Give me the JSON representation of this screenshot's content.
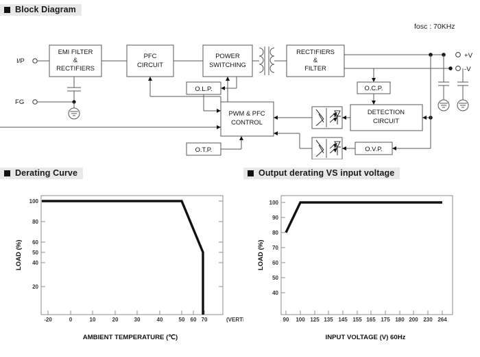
{
  "sections": {
    "block_diagram": {
      "title": "Block Diagram",
      "bullet_color": "#111111",
      "header_bg": "#e8e8e8"
    },
    "derating_curve": {
      "title": "Derating Curve"
    },
    "output_derating": {
      "title": "Output derating VS input voltage"
    }
  },
  "block_diagram": {
    "fosc_label": "fosc : 70KHz",
    "terminals": [
      {
        "name": "input",
        "label": "I/P"
      },
      {
        "name": "frame-ground",
        "label": "FG"
      },
      {
        "name": "output-positive",
        "label": "+V"
      },
      {
        "name": "output-negative",
        "label": "-V"
      }
    ],
    "blocks": [
      {
        "id": "emi",
        "lines": [
          "EMI FILTER",
          "&",
          "RECTIFIERS"
        ]
      },
      {
        "id": "pfc",
        "lines": [
          "PFC",
          "CIRCUIT"
        ]
      },
      {
        "id": "power_sw",
        "lines": [
          "POWER",
          "SWITCHING"
        ]
      },
      {
        "id": "rect_filter",
        "lines": [
          "RECTIFIERS",
          "&",
          "FILTER"
        ]
      },
      {
        "id": "olp",
        "lines": [
          "O.L.P."
        ]
      },
      {
        "id": "pwm_pfc",
        "lines": [
          "PWM & PFC",
          "CONTROL"
        ]
      },
      {
        "id": "otp",
        "lines": [
          "O.T.P."
        ]
      },
      {
        "id": "ocp",
        "lines": [
          "O.C.P."
        ]
      },
      {
        "id": "detection",
        "lines": [
          "DETECTION",
          "CIRCUIT"
        ]
      },
      {
        "id": "ovp",
        "lines": [
          "O.V.P."
        ]
      }
    ]
  },
  "chart_data": [
    {
      "type": "line",
      "name": "derating-curve",
      "title": "Derating Curve",
      "xlabel": "AMBIENT TEMPERATURE (℃)",
      "ylabel": "LOAD (%)",
      "xlim": [
        -30,
        75
      ],
      "ylim": [
        0,
        110
      ],
      "xticks": [
        -20,
        0,
        10,
        20,
        30,
        40,
        50,
        60,
        70
      ],
      "xtick_labels": [
        "-20",
        "0",
        "10",
        "20",
        "30",
        "40",
        "50",
        "60",
        "70"
      ],
      "yticks": [
        20,
        40,
        50,
        60,
        80,
        100
      ],
      "ytick_labels": [
        "20",
        "40",
        "50",
        "60",
        "80",
        "100"
      ],
      "grid": false,
      "legend": "none",
      "annotation": "(VERTICAL)",
      "x": [
        -30,
        50,
        69,
        69
      ],
      "y": [
        100,
        100,
        50,
        0
      ],
      "points": [
        {
          "x": -30,
          "y": 100
        },
        {
          "x": 50,
          "y": 100
        },
        {
          "x": 69,
          "y": 50
        },
        {
          "x": 69,
          "y": 0
        }
      ]
    },
    {
      "type": "line",
      "name": "output-derating-vs-input-voltage",
      "title": "Output derating VS input voltage",
      "xlabel": "INPUT VOLTAGE (V) 60Hz",
      "ylabel": "LOAD (%)",
      "xlim": [
        0,
        11
      ],
      "ylim": [
        30,
        110
      ],
      "xticks": [
        0,
        1,
        2,
        3,
        4,
        5,
        6,
        7,
        8,
        9,
        10,
        11
      ],
      "xtick_labels": [
        "90",
        "100",
        "125",
        "135",
        "145",
        "155",
        "165",
        "175",
        "180",
        "200",
        "230",
        "264"
      ],
      "yticks": [
        40,
        50,
        60,
        70,
        80,
        90,
        100
      ],
      "ytick_labels": [
        "40",
        "50",
        "60",
        "70",
        "80",
        "90",
        "100"
      ],
      "grid": false,
      "legend": "none",
      "x": [
        0,
        1,
        11
      ],
      "y": [
        80,
        100,
        100
      ],
      "points": [
        {
          "x": 0,
          "y": 80,
          "xlabel": "90"
        },
        {
          "x": 1,
          "y": 100,
          "xlabel": "100"
        },
        {
          "x": 11,
          "y": 100,
          "xlabel": "264"
        }
      ]
    }
  ]
}
